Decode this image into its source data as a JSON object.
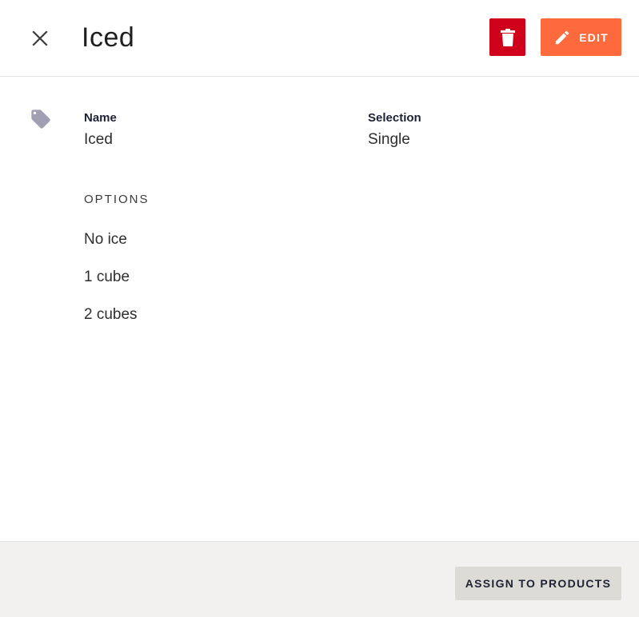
{
  "header": {
    "title": "Iced",
    "edit_label": "EDIT",
    "delete_color": "#d0021b",
    "edit_color": "#ff6a3d"
  },
  "icons": {
    "close": "close-icon",
    "delete": "trash-icon",
    "edit": "pencil-icon",
    "tag": "tag-icon"
  },
  "details": {
    "name_label": "Name",
    "name_value": "Iced",
    "selection_label": "Selection",
    "selection_value": "Single"
  },
  "options": {
    "header": "OPTIONS",
    "items": [
      "No ice",
      "1 cube",
      "2 cubes"
    ]
  },
  "footer": {
    "assign_label": "ASSIGN TO PRODUCTS"
  }
}
